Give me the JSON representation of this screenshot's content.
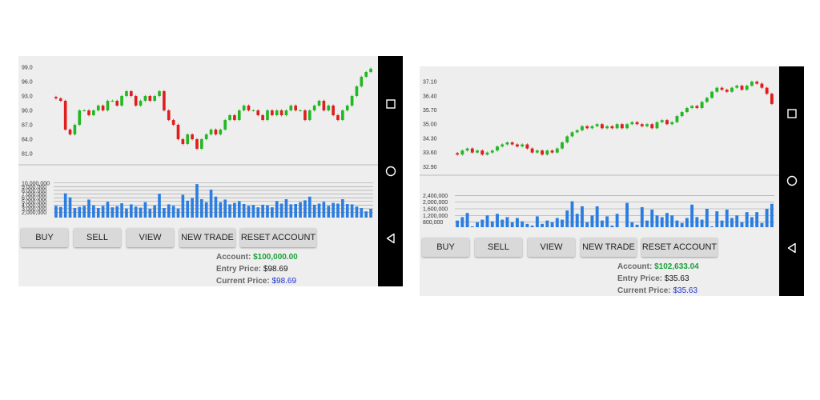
{
  "colors": {
    "up": "#22b822",
    "down": "#e01e1e",
    "volume": "#2a7de1",
    "account": "#1aa13a",
    "current": "#2233cc"
  },
  "screens": [
    {
      "buttons": [
        "BUY",
        "SELL",
        "VIEW",
        "NEW TRADE",
        "RESET ACCOUNT"
      ],
      "account_label": "Account:",
      "account_value": "$100,000.00",
      "entry_label": "Entry Price:",
      "entry_value": "$98.69",
      "current_label": "Current Price:",
      "current_value": "$98.69"
    },
    {
      "buttons": [
        "BUY",
        "SELL",
        "VIEW",
        "NEW TRADE",
        "RESET ACCOUNT"
      ],
      "account_label": "Account:",
      "account_value": "$102,633.04",
      "entry_label": "Entry Price:",
      "entry_value": "$35.63",
      "current_label": "Current Price:",
      "current_value": "$35.63"
    }
  ],
  "navbar": {
    "icons": [
      "recents-square-icon",
      "home-circle-icon",
      "back-triangle-icon"
    ]
  },
  "chart_data": [
    {
      "type": "candlestick",
      "ylim": [
        80,
        100
      ],
      "price_ticks": [
        "99.0",
        "96.0",
        "93.0",
        "90.0",
        "87.0",
        "84.0",
        "81.0"
      ],
      "price_tick_values": [
        99,
        96,
        93,
        90,
        87,
        84,
        81
      ],
      "close": [
        92.5,
        92,
        86,
        85,
        87,
        90,
        90,
        89,
        90,
        91,
        90,
        92,
        92,
        91,
        93,
        94,
        93,
        91,
        92,
        93,
        92,
        93,
        94,
        90,
        88,
        87,
        84,
        83,
        85,
        84,
        82,
        84,
        85,
        86,
        85,
        86,
        88,
        89,
        88,
        90,
        91,
        90,
        90,
        89,
        88,
        90,
        89,
        90,
        89,
        90,
        91,
        90,
        90,
        88,
        90,
        91,
        92,
        90,
        91,
        89,
        88,
        90,
        91,
        93,
        95,
        97,
        98,
        98.69
      ],
      "volume": [
        3.8,
        3.5,
        7.2,
        6.1,
        3.2,
        3.5,
        3.8,
        5.5,
        3.9,
        3.2,
        3.8,
        4.9,
        3.4,
        3.7,
        4.5,
        3.1,
        4.2,
        3.6,
        3.3,
        4.8,
        3.0,
        3.9,
        7.1,
        3.2,
        4.2,
        3.8,
        3.1,
        6.8,
        5.2,
        5.9,
        9.7,
        5.6,
        4.8,
        8.2,
        6.3,
        4.8,
        5.5,
        4.2,
        4.6,
        5.1,
        4.3,
        3.8,
        4.0,
        3.4,
        4.1,
        3.9,
        3.4,
        5.1,
        4.4,
        5.6,
        4.2,
        4.3,
        4.8,
        5.3,
        6.3,
        4.1,
        4.4,
        4.9,
        3.8,
        4.6,
        4.4,
        5.6,
        4.3,
        4.2,
        3.6,
        3.2,
        2.3,
        3.0
      ],
      "volume_ticks": [
        "10,000,000",
        "9,000,000",
        "8,000,000",
        "7,000,000",
        "6,000,000",
        "5,000,000",
        "4,000,000",
        "3,000,000",
        "2,000,000"
      ],
      "volume_tick_values": [
        10,
        9,
        8,
        7,
        6,
        5,
        4,
        3,
        2
      ],
      "volume_ylim": [
        0.6,
        10.6
      ]
    },
    {
      "type": "candlestick",
      "ylim": [
        32.6,
        37.3
      ],
      "price_ticks": [
        "37.10",
        "36.40",
        "35.70",
        "35.00",
        "34.30",
        "33.60",
        "32.90"
      ],
      "price_tick_values": [
        37.1,
        36.4,
        35.7,
        35.0,
        34.3,
        33.6,
        32.9
      ],
      "close": [
        33.5,
        33.7,
        33.8,
        33.6,
        33.7,
        33.5,
        33.6,
        33.7,
        33.9,
        34.0,
        34.1,
        34.0,
        33.9,
        34.0,
        33.8,
        33.6,
        33.7,
        33.5,
        33.7,
        33.6,
        33.8,
        34.1,
        34.4,
        34.6,
        34.7,
        34.9,
        34.8,
        34.9,
        35.0,
        34.8,
        34.9,
        34.8,
        35.0,
        34.8,
        35.0,
        35.1,
        35.0,
        34.9,
        35.0,
        34.8,
        35.1,
        35.2,
        35.0,
        35.1,
        35.4,
        35.6,
        35.8,
        35.9,
        35.8,
        36.1,
        36.3,
        36.6,
        36.8,
        36.7,
        36.6,
        36.8,
        36.9,
        36.7,
        36.9,
        37.1,
        37.0,
        36.8,
        36.5,
        36.0
      ],
      "volume": [
        0.9,
        1.1,
        1.35,
        0.55,
        0.8,
        0.95,
        1.2,
        0.85,
        1.3,
        0.95,
        1.1,
        0.8,
        1.05,
        0.85,
        0.7,
        0.6,
        1.15,
        0.7,
        0.9,
        0.8,
        1.05,
        0.95,
        1.5,
        2.05,
        1.3,
        1.75,
        0.8,
        1.2,
        1.75,
        0.9,
        1.15,
        0.6,
        1.3,
        0.5,
        1.95,
        0.8,
        0.65,
        1.7,
        0.9,
        1.55,
        1.2,
        1.1,
        1.35,
        1.2,
        0.9,
        0.75,
        1.05,
        1.85,
        1.1,
        0.95,
        1.6,
        0.55,
        1.45,
        0.9,
        1.55,
        1.05,
        1.2,
        0.8,
        1.4,
        1.1,
        1.4,
        0.75,
        1.6,
        1.9
      ],
      "volume_ticks": [
        "2,400,000",
        "2,000,000",
        "1,600,000",
        "1,200,000",
        "800,000"
      ],
      "volume_tick_values": [
        2.4,
        2.0,
        1.6,
        1.2,
        0.8
      ],
      "volume_ylim": [
        0.5,
        2.7
      ]
    }
  ]
}
